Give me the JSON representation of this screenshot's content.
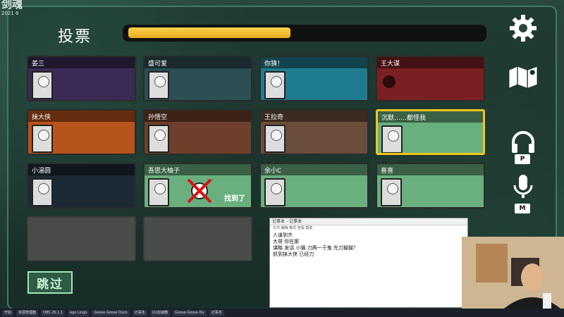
{
  "overlay": {
    "logo_big": "剑魂",
    "logo_small": "2021 6"
  },
  "header": {
    "title": "投票",
    "timer_progress": 0.46
  },
  "players": [
    {
      "name": "姜三",
      "state": "alive",
      "bg": "#3a2a55"
    },
    {
      "name": "盛可爱",
      "state": "alive",
      "bg": "#2c4e55"
    },
    {
      "name": "你猜！",
      "state": "alive",
      "bg": "#1f7c8e"
    },
    {
      "name": "王大谋",
      "state": "dead",
      "bg": "#7a1f22"
    },
    {
      "name": "抹大侠",
      "state": "alive",
      "bg": "#b7531c"
    },
    {
      "name": "孙悟空",
      "state": "alive",
      "bg": "#6e3f2a"
    },
    {
      "name": "王拉奇",
      "state": "alive",
      "bg": "#6b4d3b"
    },
    {
      "name": "沉默……都怪我",
      "state": "alive",
      "bg": "#6ab07f",
      "selected": true
    },
    {
      "name": "小湯圆",
      "state": "alive",
      "bg": "#1c2a35"
    },
    {
      "name": "吾思大柚子",
      "state": "dead",
      "bg": "#6ab07f",
      "found_text": "找到了"
    },
    {
      "name": "余小C",
      "state": "dead",
      "bg": "#6ab07f"
    },
    {
      "name": "喜喜",
      "state": "dead",
      "bg": "#6ab07f"
    }
  ],
  "skip_label": "跳过",
  "side_controls": [
    {
      "icon": "gear-icon"
    },
    {
      "icon": "map-icon"
    },
    {
      "icon": "headphones-icon",
      "key": "P"
    },
    {
      "icon": "microphone-icon",
      "key": "M"
    }
  ],
  "notepad": {
    "title": "记事本 - 记事本",
    "menu": "文件  编辑  格式  查看  帮助",
    "lines": [
      "人谋到齐",
      "大哥 你在那",
      "谋略 发话 小猫 刀两一于鬼 先刀猫猫？",
      "抓到抹大侠 已经刀"
    ]
  },
  "taskbar": [
    "开始",
    "资源管理器",
    "OBS 26.1.1",
    "ego Lingo",
    "Goose Goose Duck",
    "记事本",
    "UU加速器",
    "Goose Goose Du",
    "记事本"
  ]
}
